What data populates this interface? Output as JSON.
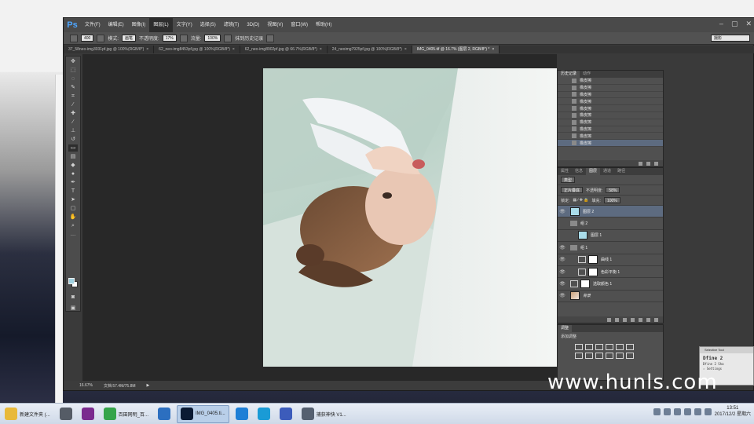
{
  "app": {
    "logo": "Ps",
    "menu": [
      "文件(F)",
      "编辑(E)",
      "图像(I)",
      "图层(L)",
      "文字(Y)",
      "选择(S)",
      "滤镜(T)",
      "3D(D)",
      "视图(V)",
      "窗口(W)",
      "帮助(H)"
    ],
    "active_menu_index": 3,
    "window_controls": [
      "–",
      "▢",
      "✕"
    ]
  },
  "options": {
    "brush_size": "400",
    "mode_label": "模式:",
    "mode_value": "画笔",
    "opacity_label": "不透明度:",
    "opacity_value": "17%",
    "flow_label": "流量:",
    "flow_value": "100%",
    "history_label": "抹到历史记录",
    "workspace": "摄影"
  },
  "doc_tabs": [
    {
      "label": "37_58neo-img3031pf.jpg @ 100%(RGB/8*)",
      "close": "×",
      "active": false
    },
    {
      "label": "62_neo-img8453pf.jpg @ 100%(RGB/8*)",
      "close": "×",
      "active": false
    },
    {
      "label": "62_neo-img8902pf.jpg @ 66.7%(RGB/8*)",
      "close": "×",
      "active": false
    },
    {
      "label": "24_neoimg7925pf.jpg @ 100%(RGB/8*)",
      "close": "×",
      "active": false
    },
    {
      "label": "IMG_0405.tif @ 16.7% (图层 2, RGB/8*) *",
      "close": "×",
      "active": true
    }
  ],
  "status": {
    "zoom": "16.67%",
    "doc": "文档:57.4M/75.8M",
    "arrow": "▶"
  },
  "history_panel": {
    "tabs": [
      "历史记录",
      "动作"
    ],
    "items": [
      "橡皮擦",
      "橡皮擦",
      "橡皮擦",
      "橡皮擦",
      "橡皮擦",
      "橡皮擦",
      "橡皮擦",
      "橡皮擦",
      "橡皮擦",
      "橡皮擦"
    ],
    "selected_index": 9
  },
  "layers_panel": {
    "tabs": [
      "属性",
      "信息",
      "图层",
      "通道",
      "路径"
    ],
    "kind": "类型",
    "blend_mode": "正片叠底",
    "opacity_label": "不透明度:",
    "opacity_value": "58%",
    "lock_label": "锁定:",
    "fill_label": "填充:",
    "fill_value": "100%",
    "layers": [
      {
        "name": "图层 2",
        "type": "cyan",
        "indent": 0,
        "eye": "👁",
        "selected": true
      },
      {
        "name": "组 2",
        "type": "folder",
        "indent": 0,
        "eye": "",
        "selected": false
      },
      {
        "name": "图层 1",
        "type": "cyan",
        "indent": 1,
        "eye": "",
        "selected": false
      },
      {
        "name": "组 1",
        "type": "folder",
        "indent": 0,
        "eye": "👁",
        "selected": false
      },
      {
        "name": "曲线 1",
        "type": "adj",
        "indent": 1,
        "eye": "👁",
        "selected": false
      },
      {
        "name": "色彩平衡 1",
        "type": "adj",
        "indent": 1,
        "eye": "👁",
        "selected": false
      },
      {
        "name": "选取颜色 1",
        "type": "adj",
        "indent": 0,
        "eye": "👁",
        "selected": false
      },
      {
        "name": "背景",
        "type": "photo",
        "indent": 0,
        "eye": "👁",
        "selected": false
      }
    ]
  },
  "adjust_panel": {
    "tab": "调整",
    "title": "添加调整"
  },
  "float_window": {
    "title": "Selective Tool",
    "lines": [
      "Dfine 2",
      "Dfine 2      Sha",
      "☆ Settings"
    ]
  },
  "watermark": "www.hunls.com",
  "taskbar": {
    "items": [
      {
        "label": "新建文件夹 (...",
        "color": "#e8b93a",
        "active": false
      },
      {
        "label": "",
        "color": "#555c66",
        "active": false
      },
      {
        "label": "",
        "color": "#7a2a8e",
        "active": false
      },
      {
        "label": "百田网明_百...",
        "color": "#35a44a",
        "active": false
      },
      {
        "label": "",
        "color": "#2c6fc0",
        "active": false
      },
      {
        "label": "IMG_0405.ti...",
        "color": "#0b1a33",
        "active": true
      },
      {
        "label": "",
        "color": "#1e7fd6",
        "active": false
      },
      {
        "label": "",
        "color": "#1a9bd6",
        "active": false
      },
      {
        "label": "",
        "color": "#3c5cbb",
        "active": false
      },
      {
        "label": "捕获神快 V1...",
        "color": "#556070",
        "active": false
      }
    ],
    "time": "13:51",
    "date": "2017/12/2 星期六"
  }
}
